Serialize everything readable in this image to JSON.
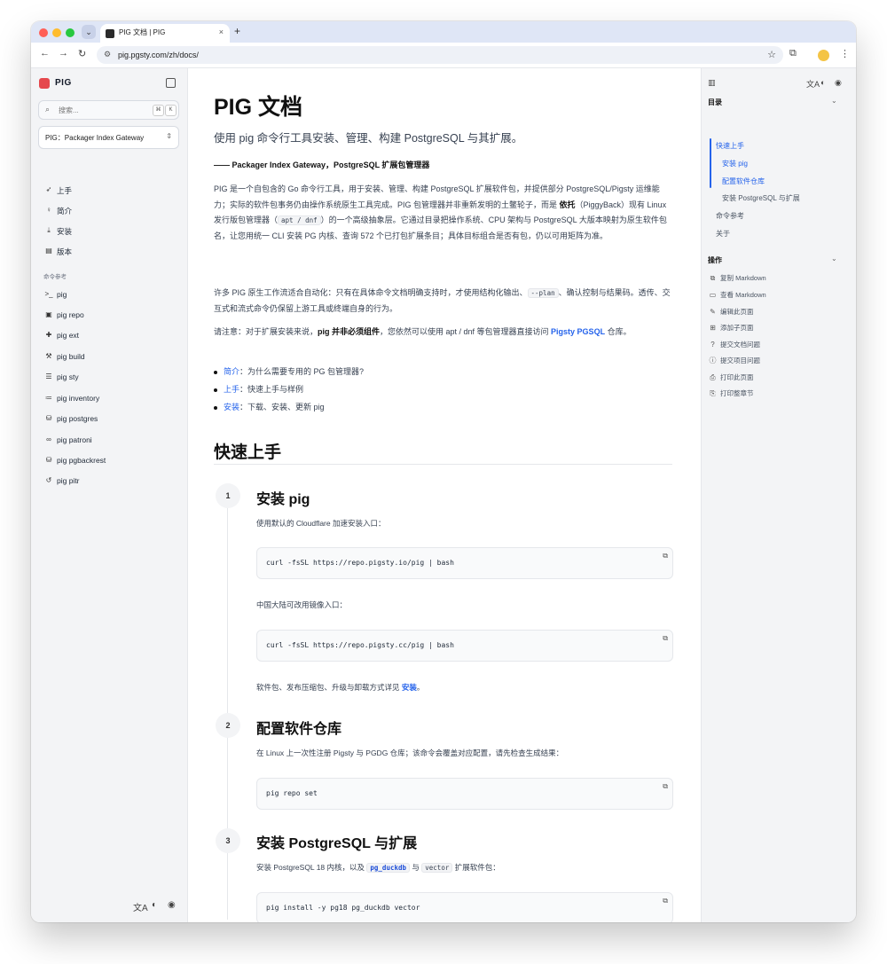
{
  "browser": {
    "tab_title": "PIG 文档 | PIG",
    "tab_close": "×",
    "new_tab": "+",
    "url": "pig.pgsty.com/zh/docs/",
    "back": "←",
    "forward": "→",
    "reload": "↻"
  },
  "sidebar": {
    "logo": "PIG",
    "search_placeholder": "搜索...",
    "kbd_cmd": "⌘",
    "kbd_k": "K",
    "project_select": "PIG：Packager Index Gateway",
    "items": [
      {
        "label": "上手",
        "icon": "rocket-icon"
      },
      {
        "label": "简介",
        "icon": "bulb-icon"
      },
      {
        "label": "安装",
        "icon": "download-icon"
      },
      {
        "label": "版本",
        "icon": "note-icon"
      }
    ],
    "section_label": "命令参考",
    "cmd_items": [
      {
        "label": "pig",
        "icon": "terminal-icon"
      },
      {
        "label": "pig repo",
        "icon": "archive-icon"
      },
      {
        "label": "pig ext",
        "icon": "puzzle-icon"
      },
      {
        "label": "pig build",
        "icon": "hammer-icon"
      },
      {
        "label": "pig sty",
        "icon": "server-icon"
      },
      {
        "label": "pig inventory",
        "icon": "list-icon"
      },
      {
        "label": "pig postgres",
        "icon": "database-icon"
      },
      {
        "label": "pig patroni",
        "icon": "infinity-icon"
      },
      {
        "label": "pig pgbackrest",
        "icon": "database-icon"
      },
      {
        "label": "pig pitr",
        "icon": "history-icon"
      }
    ]
  },
  "main": {
    "title": "PIG 文档",
    "subtitle": "使用 pig 命令行工具安装、管理、构建 PostgreSQL 与其扩展。",
    "tagline": "—— Packager Index Gateway，PostgreSQL 扩展包管理器",
    "p1_a": "PIG 是一个自包含的 Go 命令行工具，用于安装、管理、构建 PostgreSQL 扩展软件包，并提供部分 PostgreSQL/Pigsty 运维能力；实际的软件包事务仍由操作系统原生工具完成。PIG 包管理器并非重新发明的土鳖轮子，而是 ",
    "p1_bold": "依托",
    "p1_b": "（PiggyBack）现有 Linux 发行版包管理器（",
    "p1_code": "apt / dnf",
    "p1_c": "）的一个高级抽象层。它通过目录把操作系统、CPU 架构与 PostgreSQL 大版本映射为原生软件包名，让您用统一 CLI 安装 PG 内核、查询 572 个已打包扩展条目；具体目标组合是否有包，仍以可用矩阵为准。",
    "p2_a": "许多 PIG 原生工作流适合自动化：只有在具体命令文档明确支持时，才使用结构化输出、",
    "p2_code": "--plan",
    "p2_b": "、确认控制与结果码。透传、交互式和流式命令仍保留上游工具或终端自身的行为。",
    "p3_a": "请注意：对于扩展安装来说，",
    "p3_bold": "pig 并非必须组件",
    "p3_b": "，您依然可以使用 apt / dnf 等包管理器直接访问 ",
    "p3_link": "Pigsty PGSQL",
    "p3_c": " 仓库。",
    "bullets": [
      {
        "link": "简介",
        "text": "：为什么需要专用的 PG 包管理器?"
      },
      {
        "link": "上手",
        "text": "：快速上手与样例"
      },
      {
        "link": "安装",
        "text": "：下载、安装、更新 pig"
      }
    ],
    "h2": "快速上手",
    "steps": [
      {
        "num": "1",
        "title": "安装 pig"
      },
      {
        "num": "2",
        "title": "配置软件仓库"
      },
      {
        "num": "3",
        "title": "安装 PostgreSQL 与扩展"
      }
    ],
    "s1_text1": "使用默认的 Cloudflare 加速安装入口：",
    "s1_code1": "curl -fsSL https://repo.pigsty.io/pig | bash",
    "s1_text2": "中国大陆可改用镜像入口：",
    "s1_code2": "curl -fsSL https://repo.pigsty.cc/pig | bash",
    "s1_text3_a": "软件包、发布压缩包、升级与卸载方式详见 ",
    "s1_text3_link": "安装",
    "s1_text3_b": "。",
    "s2_text": "在 Linux 上一次性注册 Pigsty 与 PGDG 仓库；该命令会覆盖对应配置，请先检查生成结果：",
    "s2_code": "pig repo set",
    "s3_text_a": "安装 PostgreSQL 18 内核，以及 ",
    "s3_code1": "pg_duckdb",
    "s3_text_b": " 与 ",
    "s3_code2": "vector",
    "s3_text_c": " 扩展软件包：",
    "s3_code": "pig install -y pg18 pg_duckdb vector"
  },
  "toc": {
    "heading": "目录",
    "items": [
      {
        "label": "快速上手",
        "level": 1,
        "active": true
      },
      {
        "label": "安装 pig",
        "level": 2,
        "active": true
      },
      {
        "label": "配置软件仓库",
        "level": 2,
        "active": true
      },
      {
        "label": "安装 PostgreSQL 与扩展",
        "level": 2,
        "active": false
      },
      {
        "label": "命令参考",
        "level": 1,
        "active": false
      },
      {
        "label": "关于",
        "level": 1,
        "active": false
      }
    ],
    "actions_heading": "操作",
    "actions": [
      {
        "label": "复制 Markdown",
        "icon": "copy-icon"
      },
      {
        "label": "查看 Markdown",
        "icon": "markdown-icon"
      },
      {
        "label": "编辑此页面",
        "icon": "pencil-icon"
      },
      {
        "label": "添加子页面",
        "icon": "add-page-icon"
      },
      {
        "label": "提交文档问题",
        "icon": "help-circle-icon"
      },
      {
        "label": "提交项目问题",
        "icon": "info-circle-icon"
      },
      {
        "label": "打印此页面",
        "icon": "printer-icon"
      },
      {
        "label": "打印整章节",
        "icon": "print-section-icon"
      }
    ]
  },
  "colors": {
    "accent": "#2563eb",
    "logo": "#e5484d",
    "sidebar_bg": "#f3f4f6"
  }
}
